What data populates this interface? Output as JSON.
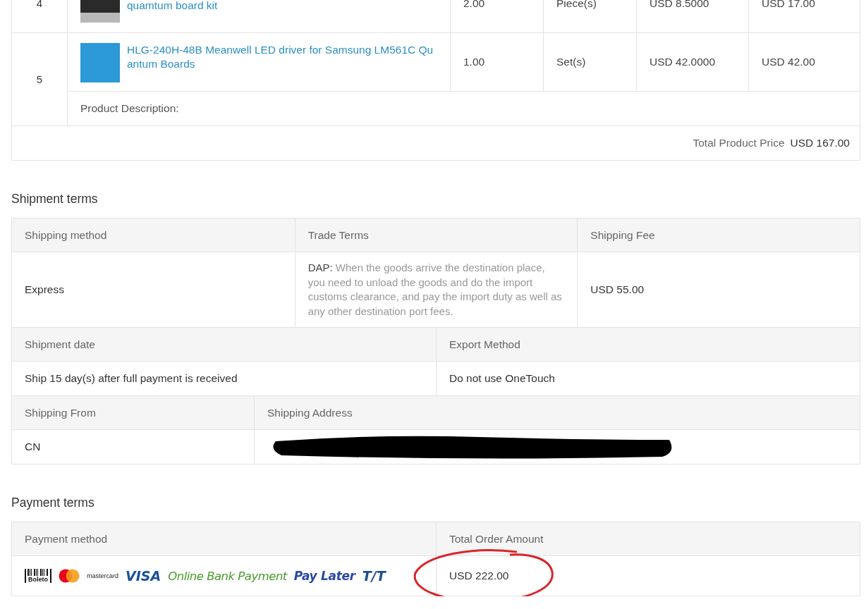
{
  "products": [
    {
      "index": "4",
      "name": "quamtum board kit",
      "quantity": "2.00",
      "unit": "Piece(s)",
      "unit_price": "USD 8.5000",
      "total": "USD 17.00",
      "cut_top": true
    },
    {
      "index": "5",
      "name": "HLG-240H-48B Meanwell LED driver for Samsung LM561C Quantum Boards",
      "quantity": "1.00",
      "unit": "Set(s)",
      "unit_price": "USD 42.0000",
      "total": "USD 42.00",
      "description_label": "Product Description:",
      "cut_top": false
    }
  ],
  "total_product_price": {
    "label": "Total Product Price",
    "value": "USD 167.00"
  },
  "shipment_terms": {
    "title": "Shipment terms",
    "sections": [
      {
        "columns": [
          {
            "kind": "text",
            "label": "Shipping method",
            "value": "Express"
          },
          {
            "kind": "term",
            "label": "Trade Terms",
            "term": "DAP:",
            "value": "When the goods arrive the destination place, you need to unload the goods and do the import customs clearance, and pay the import duty as well as any other destination port fees."
          },
          {
            "kind": "text",
            "label": "Shipping Fee",
            "value": "USD 55.00"
          }
        ]
      },
      {
        "columns": [
          {
            "kind": "text",
            "label": "Shipment date",
            "value": "Ship 15 day(s) after full payment is received"
          },
          {
            "kind": "text",
            "label": "Export Method",
            "value": "Do not use OneTouch"
          }
        ]
      },
      {
        "columns": [
          {
            "kind": "text",
            "label": "Shipping From",
            "value": "CN"
          },
          {
            "kind": "redacted",
            "label": "Shipping Address"
          }
        ]
      }
    ]
  },
  "payment_terms": {
    "title": "Payment terms",
    "method_label": "Payment method",
    "methods": [
      {
        "kind": "boleto",
        "label": "Boleto"
      },
      {
        "kind": "mastercard",
        "label": "mastercard"
      },
      {
        "kind": "visa",
        "label": "VISA"
      },
      {
        "kind": "bank",
        "label": "Online Bank Payment"
      },
      {
        "kind": "paylater",
        "label": "Pay Later"
      },
      {
        "kind": "tt",
        "label": "T/T"
      }
    ],
    "amount_label": "Total Order Amount",
    "amount": "USD 222.00",
    "amount_circled": true
  }
}
